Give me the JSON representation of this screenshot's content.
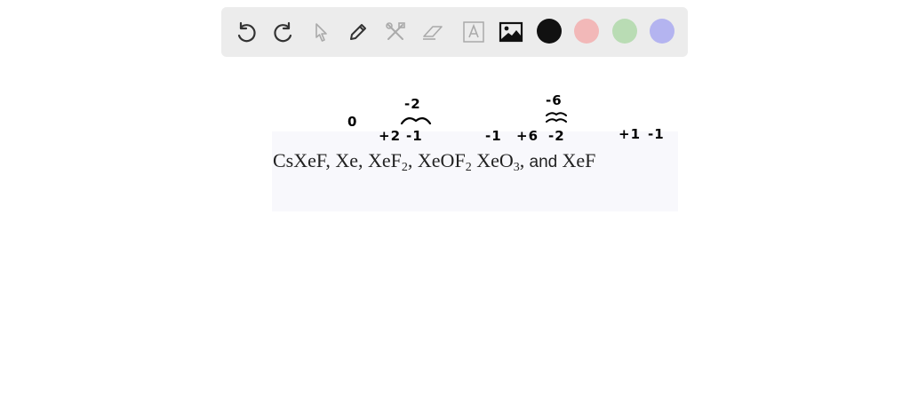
{
  "toolbar": {
    "tools": [
      "undo-icon",
      "redo-icon",
      "pointer-icon",
      "pencil-icon",
      "tools-icon",
      "eraser-icon",
      "text-icon",
      "image-icon"
    ],
    "colors": [
      "#111111",
      "#f2b8b8",
      "#b9dcb4",
      "#b4b4f0"
    ]
  },
  "formula": {
    "p1": "CsXeF, Xe, XeF",
    "sub1": "2",
    "p2": ", XeOF",
    "sub2": "2",
    "p3": " XeO",
    "sub3": "3",
    "p4": ",",
    "and": " and ",
    "p5": "XeF"
  },
  "annotations": {
    "zero": "0",
    "plus2": "+2",
    "minus2_top": "-2",
    "minus1_a": "-1",
    "minus1_b": "-1",
    "plus6": "+6",
    "minus6_top": "-6",
    "minus2": "-2",
    "plus1": "+1",
    "minus1_c": "-1"
  }
}
